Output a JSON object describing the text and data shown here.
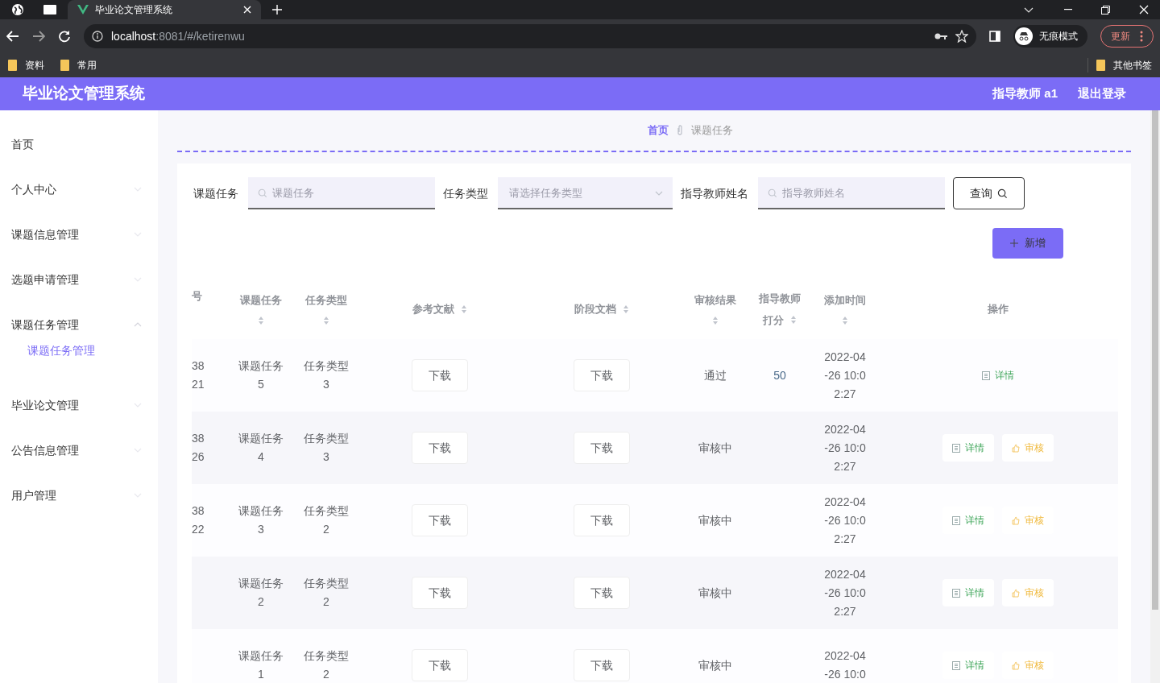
{
  "browser": {
    "tab_title": "毕业论文管理系统",
    "url_host": "localhost",
    "url_rest": ":8081/#/ketirenwu",
    "incognito_label": "无痕模式",
    "update_label": "更新",
    "bookmarks": [
      "资料",
      "常用"
    ],
    "other_bookmarks": "其他书签"
  },
  "header": {
    "title": "毕业论文管理系统",
    "user": "指导教师 a1",
    "logout": "退出登录"
  },
  "sidebar": {
    "items": [
      {
        "label": "首页"
      },
      {
        "label": "个人中心",
        "expanded": false
      },
      {
        "label": "课题信息管理",
        "expanded": false
      },
      {
        "label": "选题申请管理",
        "expanded": false
      },
      {
        "label": "课题任务管理",
        "expanded": true,
        "children": [
          {
            "label": "课题任务管理",
            "selected": true
          }
        ]
      },
      {
        "label": "毕业论文管理",
        "expanded": false
      },
      {
        "label": "公告信息管理",
        "expanded": false
      },
      {
        "label": "用户管理",
        "expanded": false
      }
    ]
  },
  "breadcrumb": [
    "首页",
    "课题任务"
  ],
  "search": {
    "fields": [
      {
        "label": "课题任务",
        "kind": "text",
        "placeholder": "课题任务"
      },
      {
        "label": "任务类型",
        "kind": "select",
        "placeholder": "请选择任务类型"
      },
      {
        "label": "指导教师姓名",
        "kind": "text",
        "placeholder": "指导教师姓名"
      }
    ],
    "query_button": "查询",
    "add_button": "新增"
  },
  "table": {
    "columns": [
      {
        "label": "号",
        "sortable": false
      },
      {
        "label": "课题任务",
        "sortable": true
      },
      {
        "label": "任务类型",
        "sortable": true
      },
      {
        "label": "参考文献",
        "sortable": true
      },
      {
        "label": "阶段文档",
        "sortable": true
      },
      {
        "label": "审核结果",
        "sortable": true
      },
      {
        "label": "指导教师打分",
        "sortable": true
      },
      {
        "label": "添加时间",
        "sortable": true
      },
      {
        "label": "操作",
        "sortable": false
      }
    ],
    "rows": [
      {
        "id": [
          "38",
          "21"
        ],
        "task": [
          "课题任务",
          "5"
        ],
        "type": [
          "任务类型",
          "3"
        ],
        "ref": "下载",
        "doc": "下载",
        "result": "通过",
        "score": "50",
        "time": [
          "2022-04",
          "-26 10:0",
          "2:27"
        ],
        "actions": [
          {
            "kind": "detail",
            "label": "详情"
          }
        ]
      },
      {
        "id": [
          "38",
          "26"
        ],
        "task": [
          "课题任务",
          "4"
        ],
        "type": [
          "任务类型",
          "3"
        ],
        "ref": "下载",
        "doc": "下载",
        "result": "审核中",
        "time": [
          "2022-04",
          "-26 10:0",
          "2:27"
        ],
        "actions": [
          {
            "kind": "detail",
            "label": "详情"
          },
          {
            "kind": "review",
            "label": "审核"
          }
        ]
      },
      {
        "id": [
          "38",
          "22"
        ],
        "task": [
          "课题任务",
          "3"
        ],
        "type": [
          "任务类型",
          "2"
        ],
        "ref": "下载",
        "doc": "下载",
        "result": "审核中",
        "time": [
          "2022-04",
          "-26 10:0",
          "2:27"
        ],
        "actions": [
          {
            "kind": "detail",
            "label": "详情"
          },
          {
            "kind": "review",
            "label": "审核"
          }
        ]
      },
      {
        "task": [
          "课题任务",
          "2"
        ],
        "type": [
          "任务类型",
          "2"
        ],
        "ref": "下载",
        "doc": "下载",
        "result": "审核中",
        "time": [
          "2022-04",
          "-26 10:0",
          "2:27"
        ],
        "actions": [
          {
            "kind": "detail",
            "label": "详情"
          },
          {
            "kind": "review",
            "label": "审核"
          }
        ]
      },
      {
        "task": [
          "课题任务",
          "1"
        ],
        "type": [
          "任务类型",
          "2"
        ],
        "ref": "下载",
        "doc": "下载",
        "result": "审核中",
        "time": [
          "2022-04",
          "-26 10:0"
        ],
        "actions": [
          {
            "kind": "detail",
            "label": "详情"
          },
          {
            "kind": "review",
            "label": "审核"
          }
        ]
      }
    ]
  }
}
